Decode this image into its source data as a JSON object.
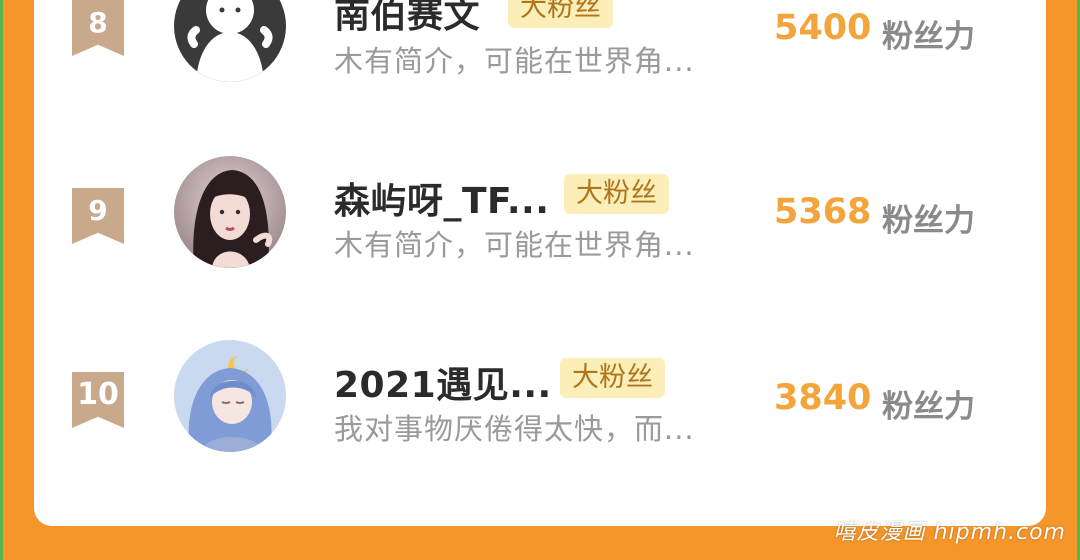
{
  "ranking": {
    "items": [
      {
        "rank": "8",
        "name": "南伯赛文",
        "badge": "大粉丝",
        "bio": "木有简介，可能在世界角...",
        "score": "5400",
        "score_unit": "粉丝力",
        "avatar": "default-silhouette-avatar"
      },
      {
        "rank": "9",
        "name": "森屿呀_TF...",
        "badge": "大粉丝",
        "bio": "木有简介，可能在世界角...",
        "score": "5368",
        "score_unit": "粉丝力",
        "avatar": "girl-portrait-avatar"
      },
      {
        "rank": "10",
        "name": "2021遇见...",
        "badge": "大粉丝",
        "bio": "我对事物厌倦得太快，而...",
        "score": "3840",
        "score_unit": "粉丝力",
        "avatar": "blue-hair-anime-avatar"
      }
    ]
  },
  "watermark": "嘻皮漫画 hipmh.com",
  "colors": {
    "frame": "#f6962a",
    "rank_ribbon": "#c9a98c",
    "badge_bg": "#fbeeb9",
    "score": "#f3a43a"
  }
}
